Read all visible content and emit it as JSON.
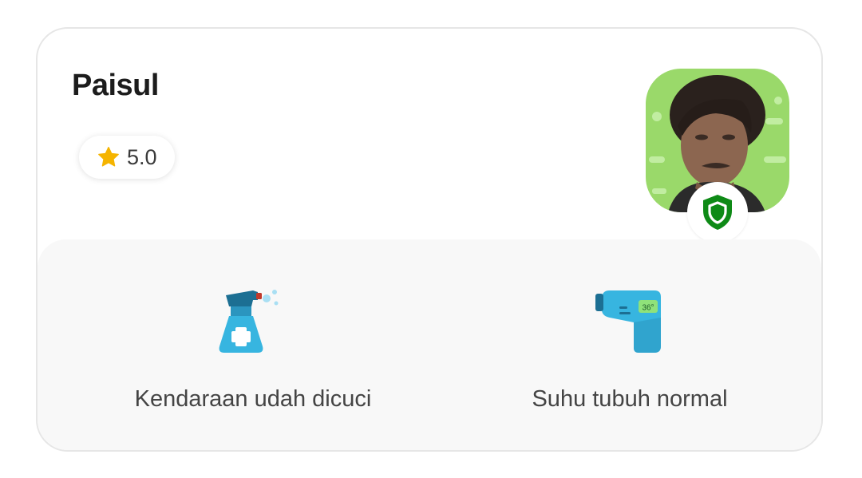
{
  "driver": {
    "name": "Paisul",
    "rating": "5.0",
    "rating_icon": "star-icon",
    "verified_icon": "shield-icon"
  },
  "safety": {
    "items": [
      {
        "label": "Kendaraan udah dicuci",
        "icon": "sanitizer-spray-icon"
      },
      {
        "label": "Suhu tubuh normal",
        "icon": "thermometer-gun-icon",
        "icon_text": "36°"
      }
    ]
  },
  "colors": {
    "star": "#F5B400",
    "shield": "#0E8A16",
    "accent_blue": "#37B5E0",
    "avatar_bg": "#9AD96A"
  }
}
